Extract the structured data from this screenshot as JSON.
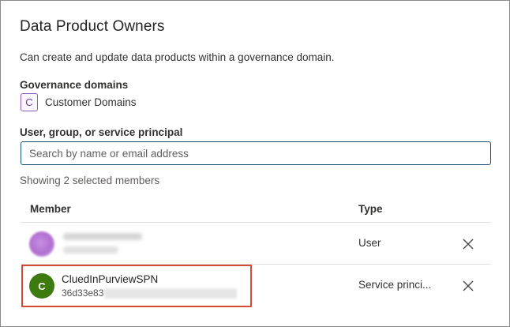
{
  "dialog": {
    "title": "Data Product Owners",
    "description": "Can create and update data products within a governance domain."
  },
  "governance": {
    "label": "Governance domains",
    "domain": {
      "initial": "C",
      "name": "Customer Domains"
    }
  },
  "picker": {
    "label": "User, group, or service principal",
    "placeholder": "Search by name or email address"
  },
  "members": {
    "summary": "Showing 2 selected members",
    "headers": {
      "member": "Member",
      "type": "Type"
    },
    "rows": [
      {
        "name": "",
        "email": "",
        "type": "User",
        "avatar_color": "#b06ed0",
        "redacted": true
      },
      {
        "name": "CluedInPurviewSPN",
        "id_prefix": "36d33e83",
        "type": "Service princi...",
        "avatar_initial": "C",
        "avatar_color": "#3d7a0f",
        "redacted_id": true
      }
    ]
  },
  "icons": {
    "remove": "close-icon"
  },
  "colors": {
    "highlight": "#d44a35",
    "input_border": "#1b4f72",
    "domain_chip": "#8e5cbc"
  }
}
